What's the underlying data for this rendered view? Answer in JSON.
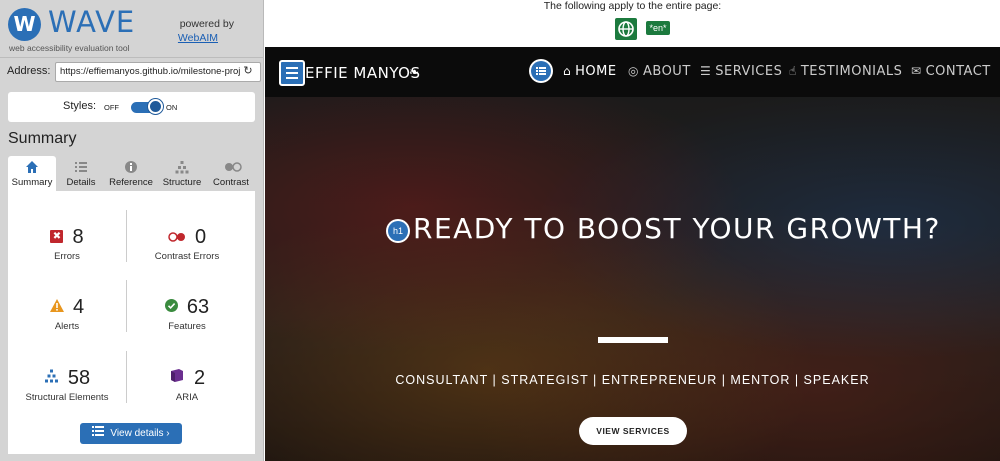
{
  "wave": {
    "name": "WAVE",
    "subtitle": "web accessibility evaluation tool",
    "powered_by": "powered by",
    "powered_link": "WebAIM",
    "address_label": "Address:",
    "address_value": "https://effiemanyos.github.io/milestone-proj",
    "styles_label": "Styles:",
    "toggle_off": "OFF",
    "toggle_on": "ON",
    "summary_title": "Summary",
    "tabs": [
      {
        "label": "Summary",
        "icon": "home-icon",
        "active": true
      },
      {
        "label": "Details",
        "icon": "list-icon",
        "active": false
      },
      {
        "label": "Reference",
        "icon": "info-icon",
        "active": false
      },
      {
        "label": "Structure",
        "icon": "structure-icon",
        "active": false
      },
      {
        "label": "Contrast",
        "icon": "contrast-icon",
        "active": false
      }
    ],
    "stats": {
      "errors": {
        "count": "8",
        "label": "Errors"
      },
      "contrast_errors": {
        "count": "0",
        "label": "Contrast Errors"
      },
      "alerts": {
        "count": "4",
        "label": "Alerts"
      },
      "features": {
        "count": "63",
        "label": "Features"
      },
      "structural": {
        "count": "58",
        "label": "Structural Elements"
      },
      "aria": {
        "count": "2",
        "label": "ARIA"
      }
    },
    "view_details": "View details ›"
  },
  "main": {
    "apply_text": "The following apply to the entire page:",
    "lang_badge": "*en*"
  },
  "site": {
    "brand": "EFFIE MANYOS",
    "nav": [
      {
        "label": "HOME",
        "icon": "home-icon",
        "active": true
      },
      {
        "label": "ABOUT",
        "icon": "user-icon",
        "active": false
      },
      {
        "label": "SERVICES",
        "icon": "list-icon",
        "active": false
      },
      {
        "label": "TESTIMONIALS",
        "icon": "thumbs-up-icon",
        "active": false
      },
      {
        "label": "CONTACT",
        "icon": "envelope-icon",
        "active": false
      }
    ],
    "h1_badge": "h1",
    "hero_title": "READY TO BOOST YOUR GROWTH?",
    "hero_subtitle": "CONSULTANT | STRATEGIST | ENTREPRENEUR | MENTOR | SPEAKER",
    "cta": "VIEW SERVICES"
  },
  "colors": {
    "wave_blue": "#2b6fb6",
    "error_red": "#c0272d",
    "alert_orange": "#e8961e",
    "feature_green": "#3a8b3f",
    "aria_purple": "#6b2e8f",
    "lang_green": "#1c7a3e"
  }
}
